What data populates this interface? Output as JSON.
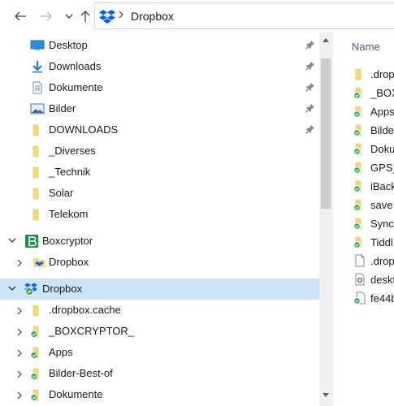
{
  "window": {
    "title": "Dropbox"
  },
  "address_bar": {
    "back_icon": "arrow-left-icon",
    "forward_icon": "arrow-right-icon",
    "recent_icon": "chevron-down-icon",
    "up_icon": "arrow-up-icon",
    "location_icon": "dropbox-icon",
    "path": "Dropbox"
  },
  "nav_pane": {
    "items": [
      {
        "label": "Desktop",
        "icon": "desktop-folder-icon",
        "pinned": true
      },
      {
        "label": "Downloads",
        "icon": "download-folder-icon",
        "pinned": true
      },
      {
        "label": "Dokumente",
        "icon": "documents-folder-icon",
        "pinned": true
      },
      {
        "label": "Bilder",
        "icon": "pictures-folder-icon",
        "pinned": true
      },
      {
        "label": "DOWNLOADS",
        "icon": "folder-icon",
        "pinned": true
      },
      {
        "label": "_Diverses",
        "icon": "folder-icon",
        "pinned": false
      },
      {
        "label": "_Technik",
        "icon": "folder-icon",
        "pinned": false
      },
      {
        "label": "Solar",
        "icon": "folder-icon",
        "pinned": false
      },
      {
        "label": "Telekom",
        "icon": "folder-icon",
        "pinned": false
      },
      {
        "label": "Boxcryptor",
        "icon": "boxcryptor-icon",
        "expanded": true
      },
      {
        "label": "Dropbox",
        "icon": "dropbox-icon",
        "expanded": false
      },
      {
        "label": "Dropbox",
        "icon": "dropbox-sync-icon",
        "expanded": true,
        "selected": true
      },
      {
        "label": ".dropbox.cache",
        "icon": "folder-icon",
        "expanded": false
      },
      {
        "label": "_BOXCRYPTOR_",
        "icon": "synced-folder-icon",
        "expanded": false
      },
      {
        "label": "Apps",
        "icon": "synced-folder-icon",
        "expanded": false
      },
      {
        "label": "Bilder-Best-of",
        "icon": "synced-folder-icon",
        "expanded": false
      },
      {
        "label": "Dokumente",
        "icon": "synced-folder-icon",
        "expanded": false
      }
    ]
  },
  "content": {
    "column_header": "Name",
    "items": [
      {
        "label": ".drop",
        "icon": "folder-icon"
      },
      {
        "label": "_BOX",
        "icon": "synced-folder-icon"
      },
      {
        "label": "Apps",
        "icon": "synced-folder-icon"
      },
      {
        "label": "Bilde",
        "icon": "synced-folder-icon"
      },
      {
        "label": "Doku",
        "icon": "synced-folder-icon"
      },
      {
        "label": "GPS_c",
        "icon": "synced-folder-icon"
      },
      {
        "label": "iBack",
        "icon": "synced-folder-icon"
      },
      {
        "label": "save",
        "icon": "synced-folder-icon"
      },
      {
        "label": "SyncF",
        "icon": "synced-folder-icon"
      },
      {
        "label": "Tiddl",
        "icon": "synced-folder-icon"
      },
      {
        "label": ".drop",
        "icon": "file-icon"
      },
      {
        "label": "deskt",
        "icon": "settings-file-icon"
      },
      {
        "label": "fe44b",
        "icon": "synced-file-icon"
      }
    ]
  },
  "colors": {
    "selection": "#cce4f7",
    "folder": "#f8d775",
    "dropbox_blue": "#0061fe",
    "sync_green": "#2fa84f",
    "boxcryptor_green": "#1f8b4c"
  }
}
